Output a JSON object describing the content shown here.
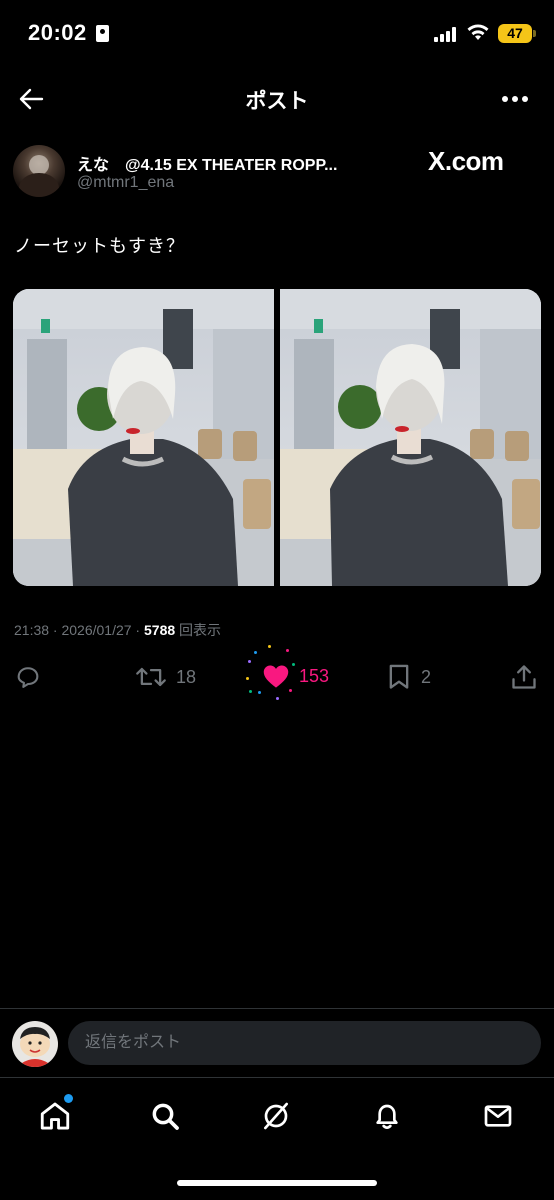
{
  "status_bar": {
    "time": "20:02",
    "battery": "47",
    "icons": [
      "id-card-icon",
      "signal-icon",
      "wifi-icon",
      "battery-icon"
    ]
  },
  "header": {
    "title": "ポスト",
    "back_icon": "arrow-left-icon",
    "more_icon": "more-horizontal-icon"
  },
  "post": {
    "author_name": "えな　@4.15 EX THEATER ROPP...",
    "author_handle": "@mtmr1_ena",
    "watermark": "X.com",
    "text": "ノーセットもすき？",
    "media_count": 2,
    "meta_time": "21:38 · 2026/01/27 · ",
    "views_count": "5788",
    "views_label": " 回表示"
  },
  "actions": {
    "reply_count": "",
    "retweet_count": "18",
    "like_count": "153",
    "bookmark_count": "2",
    "liked": true,
    "like_color": "#f91880"
  },
  "reply_bar": {
    "placeholder": "返信をポスト"
  },
  "tabbar": {
    "items": [
      "home-icon",
      "search-icon",
      "grok-icon",
      "notifications-icon",
      "messages-icon"
    ],
    "home_has_badge": true
  },
  "colors": {
    "background": "#000000",
    "text_primary": "#e7e9ea",
    "text_secondary": "#71767b",
    "accent": "#1d9bf0"
  }
}
